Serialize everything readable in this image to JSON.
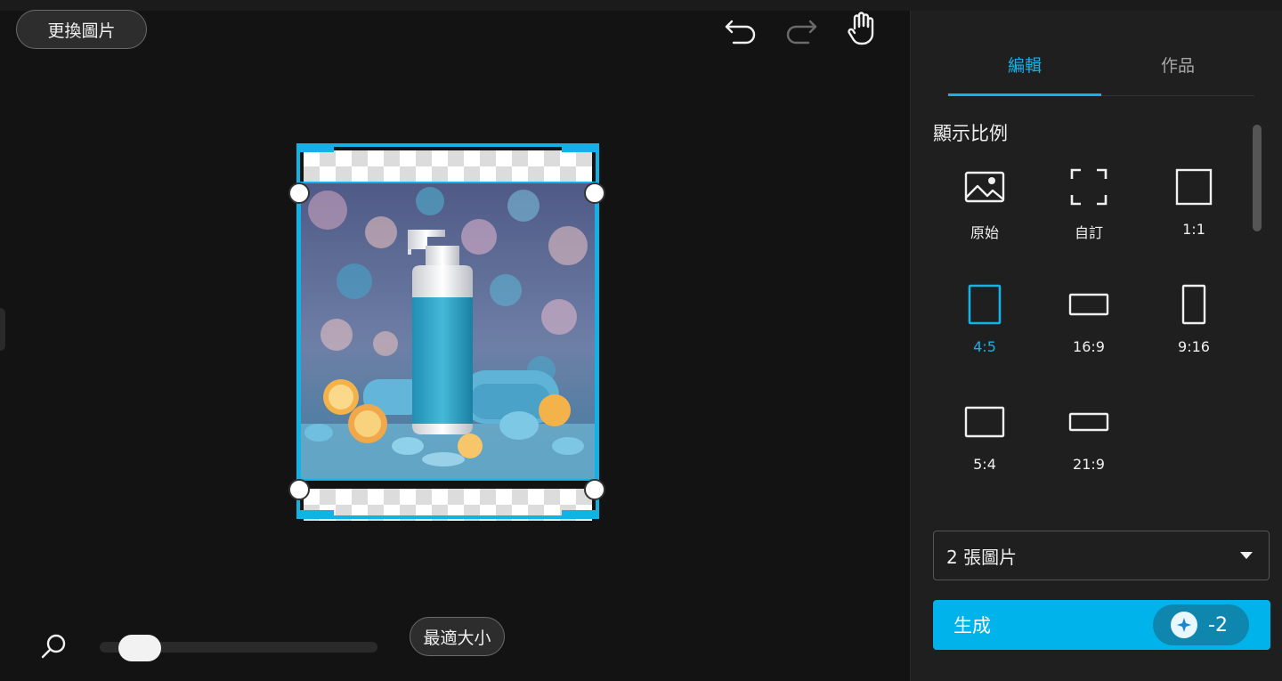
{
  "toolbar": {
    "replace_image_label": "更換圖片",
    "undo_icon": "undo-icon",
    "redo_icon": "redo-icon",
    "hand_icon": "hand-pan-icon"
  },
  "zoom": {
    "fit_label": "最適大小",
    "level_fraction": 0.08
  },
  "panel": {
    "tabs": [
      {
        "label": "編輯",
        "active": true
      },
      {
        "label": "作品",
        "active": false
      }
    ],
    "section_title": "顯示比例",
    "ratios": [
      {
        "label": "原始",
        "icon": "image-icon"
      },
      {
        "label": "自訂",
        "icon": "custom-frame-icon"
      },
      {
        "label": "1:1",
        "icon": "square-icon"
      },
      {
        "label": "4:5",
        "icon": "portrait-rect-icon",
        "active": true
      },
      {
        "label": "16:9",
        "icon": "wide-rect-icon"
      },
      {
        "label": "9:16",
        "icon": "tall-rect-icon"
      },
      {
        "label": "5:4",
        "icon": "landscape-rect-icon"
      },
      {
        "label": "21:9",
        "icon": "ultrawide-rect-icon"
      }
    ],
    "image_count": "2 張圖片",
    "generate_label": "生成",
    "credit_cost": "-2"
  },
  "colors": {
    "accent": "#00b3ea",
    "panel_bg": "#1f1f1f",
    "canvas_bg": "#131313"
  }
}
